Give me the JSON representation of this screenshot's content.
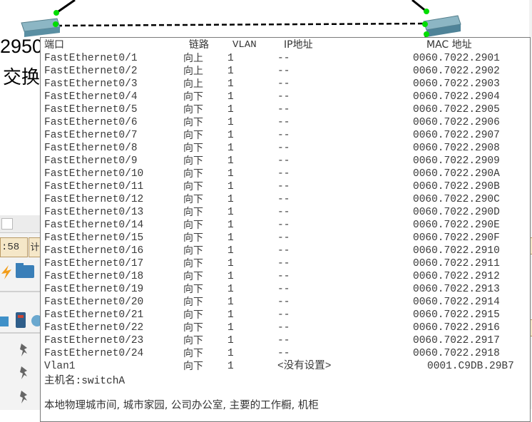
{
  "background": {
    "model_label": "2950",
    "switch_label": "交换",
    "time_fragment": ":58",
    "time_button": "计"
  },
  "tooltip": {
    "header": {
      "port": "端口",
      "link": "链路",
      "vlan": "VLAN",
      "ip": "IP地址",
      "mac": "MAC 地址"
    },
    "rows": [
      {
        "port": "FastEthernet0/1",
        "link": "向上",
        "vlan": "1",
        "ip": "--",
        "mac": "0060.7022.2901"
      },
      {
        "port": "FastEthernet0/2",
        "link": "向上",
        "vlan": "1",
        "ip": "--",
        "mac": "0060.7022.2902"
      },
      {
        "port": "FastEthernet0/3",
        "link": "向上",
        "vlan": "1",
        "ip": "--",
        "mac": "0060.7022.2903"
      },
      {
        "port": "FastEthernet0/4",
        "link": "向下",
        "vlan": "1",
        "ip": "--",
        "mac": "0060.7022.2904"
      },
      {
        "port": "FastEthernet0/5",
        "link": "向下",
        "vlan": "1",
        "ip": "--",
        "mac": "0060.7022.2905"
      },
      {
        "port": "FastEthernet0/6",
        "link": "向下",
        "vlan": "1",
        "ip": "--",
        "mac": "0060.7022.2906"
      },
      {
        "port": "FastEthernet0/7",
        "link": "向下",
        "vlan": "1",
        "ip": "--",
        "mac": "0060.7022.2907"
      },
      {
        "port": "FastEthernet0/8",
        "link": "向下",
        "vlan": "1",
        "ip": "--",
        "mac": "0060.7022.2908"
      },
      {
        "port": "FastEthernet0/9",
        "link": "向下",
        "vlan": "1",
        "ip": "--",
        "mac": "0060.7022.2909"
      },
      {
        "port": "FastEthernet0/10",
        "link": "向下",
        "vlan": "1",
        "ip": "--",
        "mac": "0060.7022.290A"
      },
      {
        "port": "FastEthernet0/11",
        "link": "向下",
        "vlan": "1",
        "ip": "--",
        "mac": "0060.7022.290B"
      },
      {
        "port": "FastEthernet0/12",
        "link": "向下",
        "vlan": "1",
        "ip": "--",
        "mac": "0060.7022.290C"
      },
      {
        "port": "FastEthernet0/13",
        "link": "向下",
        "vlan": "1",
        "ip": "--",
        "mac": "0060.7022.290D"
      },
      {
        "port": "FastEthernet0/14",
        "link": "向下",
        "vlan": "1",
        "ip": "--",
        "mac": "0060.7022.290E"
      },
      {
        "port": "FastEthernet0/15",
        "link": "向下",
        "vlan": "1",
        "ip": "--",
        "mac": "0060.7022.290F"
      },
      {
        "port": "FastEthernet0/16",
        "link": "向下",
        "vlan": "1",
        "ip": "--",
        "mac": "0060.7022.2910"
      },
      {
        "port": "FastEthernet0/17",
        "link": "向下",
        "vlan": "1",
        "ip": "--",
        "mac": "0060.7022.2911"
      },
      {
        "port": "FastEthernet0/18",
        "link": "向下",
        "vlan": "1",
        "ip": "--",
        "mac": "0060.7022.2912"
      },
      {
        "port": "FastEthernet0/19",
        "link": "向下",
        "vlan": "1",
        "ip": "--",
        "mac": "0060.7022.2913"
      },
      {
        "port": "FastEthernet0/20",
        "link": "向下",
        "vlan": "1",
        "ip": "--",
        "mac": "0060.7022.2914"
      },
      {
        "port": "FastEthernet0/21",
        "link": "向下",
        "vlan": "1",
        "ip": "--",
        "mac": "0060.7022.2915"
      },
      {
        "port": "FastEthernet0/22",
        "link": "向下",
        "vlan": "1",
        "ip": "--",
        "mac": "0060.7022.2916"
      },
      {
        "port": "FastEthernet0/23",
        "link": "向下",
        "vlan": "1",
        "ip": "--",
        "mac": "0060.7022.2917"
      },
      {
        "port": "FastEthernet0/24",
        "link": "向下",
        "vlan": "1",
        "ip": "--",
        "mac": "0060.7022.2918"
      },
      {
        "port": "Vlan1",
        "link": "向下",
        "vlan": "1",
        "ip": "<没有设置>",
        "mac": "0001.C9DB.29B7"
      }
    ],
    "hostname": "主机名:switchA",
    "location": "本地物理城市间, 城市家园, 公司办公室, 主要的工作橱, 机柜"
  },
  "colors": {
    "link_dashed": "#000000",
    "port_dot": "#00dd00",
    "switch_body": "#5a8fa3",
    "tooltip_border": "#7a7a7a"
  }
}
